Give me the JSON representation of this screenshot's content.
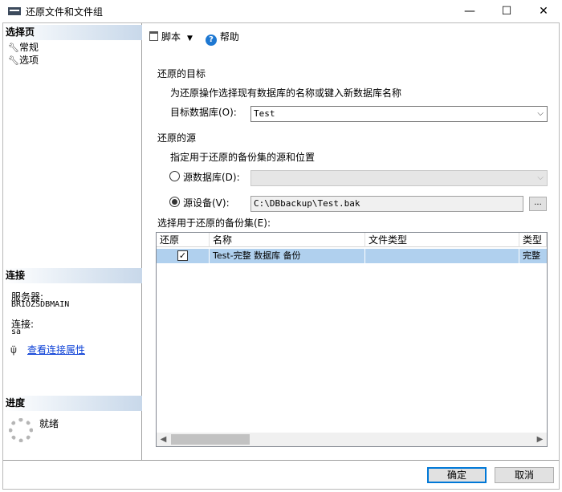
{
  "window": {
    "title": "还原文件和文件组",
    "min_glyph": "—",
    "max_glyph": "☐",
    "close_glyph": "✕"
  },
  "left_pane": {
    "select_page_header": "选择页",
    "pages": [
      {
        "label": "常规",
        "icon": "wrench-icon"
      },
      {
        "label": "选项",
        "icon": "wrench-icon"
      }
    ],
    "connection_header": "连接",
    "server_label": "服务器:",
    "server_value": "BRIOZSDBMAIN",
    "connection_label": "连接:",
    "connection_value": "sa",
    "view_connection_link": "查看连接属性",
    "progress_header": "进度",
    "progress_status": "就绪"
  },
  "toolbar": {
    "script_label": "脚本",
    "help_label": "帮助",
    "help_glyph": "?"
  },
  "destination": {
    "group_label": "还原的目标",
    "hint": "为还原操作选择现有数据库的名称或键入新数据库名称",
    "target_db_label": "目标数据库(O):",
    "target_db_value": "Test"
  },
  "source": {
    "group_label": "还原的源",
    "hint": "指定用于还原的备份集的源和位置",
    "source_db_label": "源数据库(D):",
    "source_db_value": "",
    "source_db_selected": false,
    "source_device_label": "源设备(V):",
    "source_device_value": "C:\\DBbackup\\Test.bak",
    "source_device_selected": true,
    "browse_label": "..."
  },
  "backup_sets": {
    "label": "选择用于还原的备份集(E):",
    "columns": [
      "还原",
      "名称",
      "文件类型",
      "类型"
    ],
    "rows": [
      {
        "restore": true,
        "name": "Test-完整 数据库 备份",
        "file_type": "",
        "type": "完整"
      }
    ]
  },
  "buttons": {
    "ok": "确定",
    "cancel": "取消"
  },
  "colors": {
    "accent": "#0078d7",
    "row_selected": "#b0d0ee",
    "link": "#0a3fd6"
  }
}
